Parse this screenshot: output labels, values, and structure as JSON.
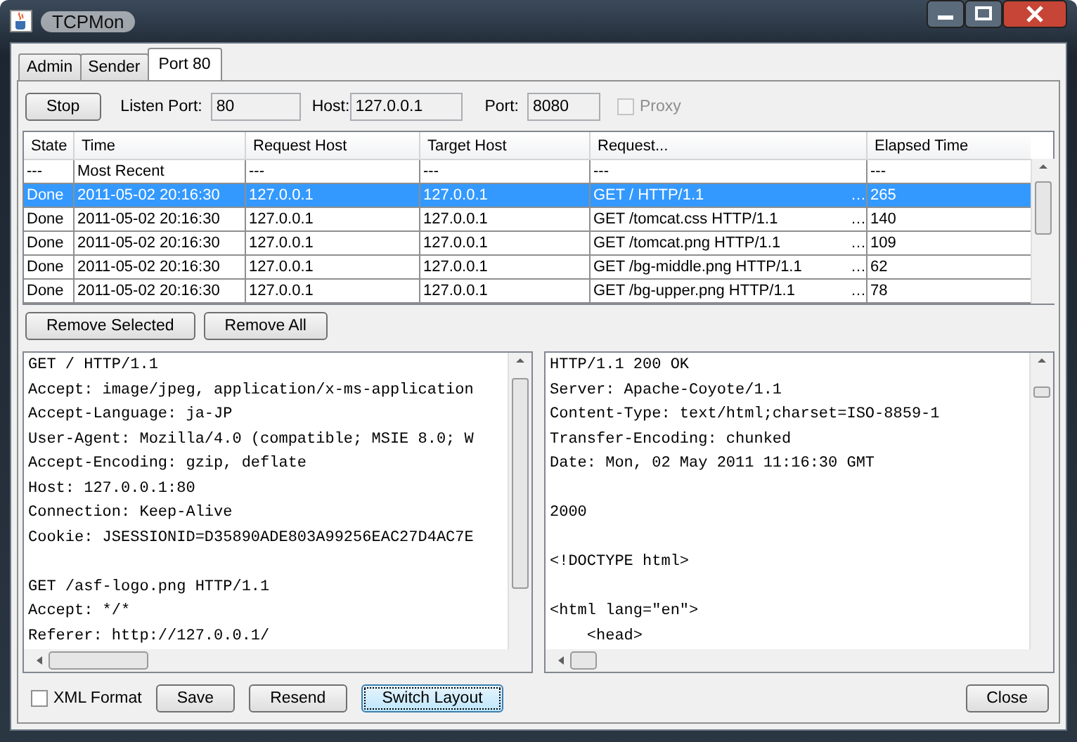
{
  "window": {
    "title": "TCPMon"
  },
  "tabs": [
    {
      "label": "Admin",
      "selected": false
    },
    {
      "label": "Sender",
      "selected": false
    },
    {
      "label": "Port 80",
      "selected": true
    }
  ],
  "toolbar": {
    "stop_button": "Stop",
    "listen_port": {
      "label": "Listen Port:",
      "value": "80"
    },
    "host": {
      "label": "Host:",
      "value": "127.0.0.1"
    },
    "port": {
      "label": "Port:",
      "value": "8080"
    },
    "proxy": {
      "label": "Proxy",
      "checked": false,
      "disabled": true
    }
  },
  "table": {
    "columns": [
      "State",
      "Time",
      "Request Host",
      "Target Host",
      "Request...",
      "Elapsed Time"
    ],
    "rows": [
      {
        "state": "---",
        "time": "Most Recent",
        "request_host": "---",
        "target_host": "---",
        "request": "---",
        "elapsed": "---",
        "selected": false
      },
      {
        "state": "Done",
        "time": "2011-05-02 20:16:30",
        "request_host": "127.0.0.1",
        "target_host": "127.0.0.1",
        "request": "GET / HTTP/1.1",
        "request_mark": "…",
        "elapsed": "265",
        "selected": true
      },
      {
        "state": "Done",
        "time": "2011-05-02 20:16:30",
        "request_host": "127.0.0.1",
        "target_host": "127.0.0.1",
        "request": "GET /tomcat.css HTTP/1.1",
        "request_mark": "…",
        "elapsed": "140",
        "selected": false
      },
      {
        "state": "Done",
        "time": "2011-05-02 20:16:30",
        "request_host": "127.0.0.1",
        "target_host": "127.0.0.1",
        "request": "GET /tomcat.png HTTP/1.1",
        "request_mark": "…",
        "elapsed": "109",
        "selected": false
      },
      {
        "state": "Done",
        "time": "2011-05-02 20:16:30",
        "request_host": "127.0.0.1",
        "target_host": "127.0.0.1",
        "request": "GET /bg-middle.png HTTP/1.1",
        "request_mark": "…",
        "elapsed": "62",
        "selected": false
      },
      {
        "state": "Done",
        "time": "2011-05-02 20:16:30",
        "request_host": "127.0.0.1",
        "target_host": "127.0.0.1",
        "request": "GET /bg-upper.png HTTP/1.1",
        "request_mark": "…",
        "elapsed": "78",
        "selected": false
      }
    ]
  },
  "table_buttons": [
    "Remove Selected",
    "Remove All"
  ],
  "request_pane": {
    "blocks": [
      [
        "GET / HTTP/1.1",
        "Accept: image/jpeg, application/x-ms-application",
        "Accept-Language: ja-JP",
        "User-Agent: Mozilla/4.0 (compatible; MSIE 8.0; W",
        "Accept-Encoding: gzip, deflate",
        "Host: 127.0.0.1:80",
        "Connection: Keep-Alive",
        "Cookie: JSESSIONID=D35890ADE803A99256EAC27D4AC7E"
      ],
      [
        "GET /asf-logo.png HTTP/1.1",
        "Accept: */*",
        "Referer: http://127.0.0.1/"
      ]
    ]
  },
  "response_pane": {
    "blocks": [
      [
        "HTTP/1.1 200 OK",
        "Server: Apache-Coyote/1.1",
        "Content-Type: text/html;charset=ISO-8859-1",
        "Transfer-Encoding: chunked",
        "Date: Mon, 02 May 2011 11:16:30 GMT"
      ],
      [
        "2000"
      ],
      [
        "<!DOCTYPE html>"
      ],
      [
        "<html lang=\"en\">",
        "    <head>"
      ]
    ]
  },
  "bottom": {
    "xml_format": {
      "label": "XML Format",
      "checked": false
    },
    "buttons": [
      "Save",
      "Resend",
      "Switch Layout"
    ],
    "close_button": "Close"
  }
}
